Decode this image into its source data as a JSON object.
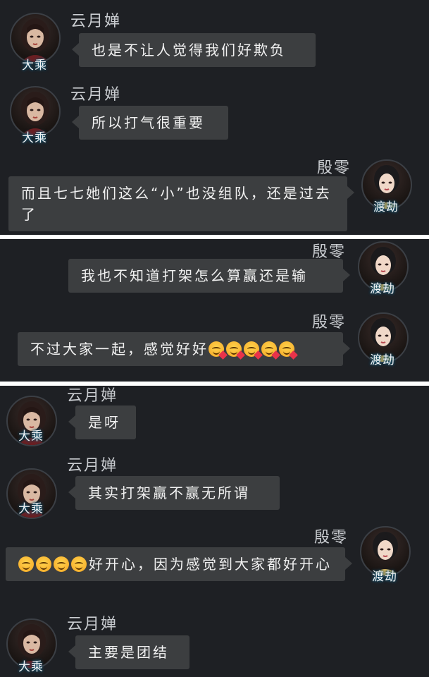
{
  "chat": {
    "messages": [
      {
        "sender": "云月婵",
        "rank": "大乘",
        "side": "left",
        "text": "也是不让人觉得我们好欺负"
      },
      {
        "sender": "云月婵",
        "rank": "大乘",
        "side": "left",
        "text": "所以打气很重要"
      },
      {
        "sender": "殷零",
        "rank": "渡劫",
        "side": "right",
        "text": "而且七七她们这么“小”也没组队，还是过去了"
      },
      {
        "sender": "殷零",
        "rank": "渡劫",
        "side": "right",
        "text": "我也不知道打架怎么算赢还是输"
      },
      {
        "sender": "殷零",
        "rank": "渡劫",
        "side": "right",
        "text": "不过大家一起，感觉好好",
        "emoji_after": 5
      },
      {
        "sender": "云月婵",
        "rank": "大乘",
        "side": "left",
        "text": "是呀"
      },
      {
        "sender": "云月婵",
        "rank": "大乘",
        "side": "left",
        "text": "其实打架赢不赢无所谓"
      },
      {
        "sender": "殷零",
        "rank": "渡劫",
        "side": "right",
        "text": "好开心，因为感觉到大家都好开心",
        "emoji_before": 4
      },
      {
        "sender": "云月婵",
        "rank": "大乘",
        "side": "left",
        "text": "主要是团结"
      }
    ]
  },
  "icons": {
    "avatar_left": "female-avatar-icon",
    "avatar_right": "female-avatar-icon",
    "emoji": "smiling-face-with-hearts-icon"
  },
  "colors": {
    "background": "#1e2024",
    "bubble": "#3c3e40",
    "text": "#f1f1f1",
    "name": "#c9ccd0"
  }
}
